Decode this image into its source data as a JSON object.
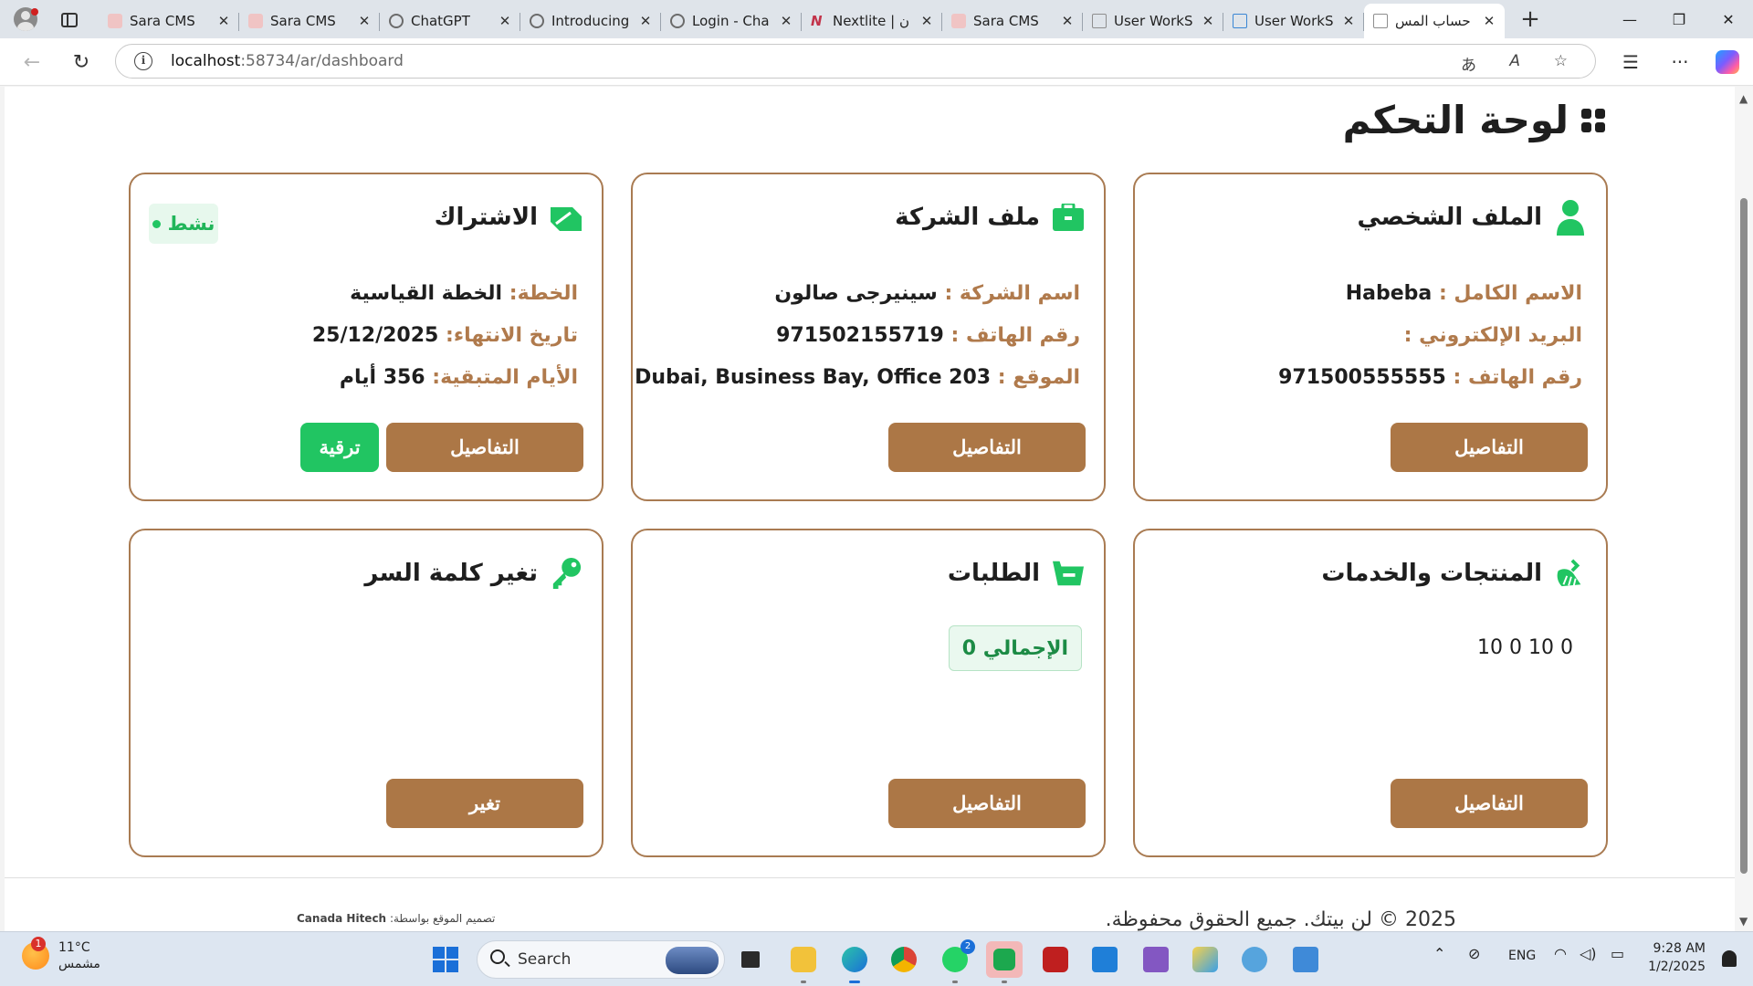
{
  "browser": {
    "tabs": [
      {
        "label": "Sara CMS",
        "favicon_color": "#d98a8a"
      },
      {
        "label": "Sara CMS",
        "favicon_color": "#d98a8a"
      },
      {
        "label": "ChatGPT",
        "favicon_color": "#6b6b6b"
      },
      {
        "label": "Introducing",
        "favicon_color": "#6b6b6b"
      },
      {
        "label": "Login - Cha",
        "favicon_color": "#6b6b6b"
      },
      {
        "label": "Nextlite | ن",
        "favicon_color": "#c2334a"
      },
      {
        "label": "Sara CMS",
        "favicon_color": "#d98a8a"
      },
      {
        "label": "User WorkS",
        "favicon_color": "#8e8e8e"
      },
      {
        "label": "User WorkS",
        "favicon_color": "#3a86d4"
      },
      {
        "label": "حساب المس",
        "favicon_color": "#8e8e8e",
        "active": true
      }
    ],
    "url_host": "localhost",
    "url_path": ":58734/ar/dashboard",
    "read_aloud": "A",
    "translate": "あ"
  },
  "page": {
    "title": "لوحة التحكم",
    "cards": {
      "profile": {
        "title": "الملف الشخصي",
        "rows": [
          {
            "label": "الاسم الكامل :",
            "value": "Habeba"
          },
          {
            "label": "البريد الإلكتروني :",
            "value": ""
          },
          {
            "label": "رقم الهاتف :",
            "value": "971500555555"
          }
        ],
        "button": "التفاصيل"
      },
      "company": {
        "title": "ملف الشركة",
        "rows": [
          {
            "label": "اسم الشركة :",
            "value": "سينيرجى صالون"
          },
          {
            "label": "رقم الهاتف :",
            "value": "971502155719"
          },
          {
            "label": "الموقع :",
            "value": "Dubai, Business Bay, Office 203"
          }
        ],
        "button": "التفاصيل"
      },
      "subscription": {
        "title": "الاشتراك",
        "status": "نشط",
        "rows": [
          {
            "label": "الخطة:",
            "value": "الخطة القياسية"
          },
          {
            "label": "تاريخ الانتهاء:",
            "value": "25/12/2025"
          },
          {
            "label": "الأيام المتبقية:",
            "value": "356 أيام"
          }
        ],
        "button": "التفاصيل",
        "upgrade_button": "ترقية"
      },
      "products": {
        "title": "المنتجات والخدمات",
        "values": "10 0 10 0",
        "button": "التفاصيل"
      },
      "orders": {
        "title": "الطلبات",
        "total_label": "الإجمالي 0",
        "button": "التفاصيل"
      },
      "password": {
        "title": "تغير كلمة السر",
        "button": "تغير"
      }
    },
    "footer": {
      "copyright": "2025 © لن بيتك. جميع الحقوق محفوظة.",
      "design_label": "تصميم الموقع بواسطة:",
      "design_company": "Canada Hitech"
    }
  },
  "taskbar": {
    "weather_temp": "11°C",
    "weather_desc": "مشمس",
    "weather_badge": "1",
    "search_placeholder": "Search",
    "whatsapp_badge": "2",
    "language": "ENG",
    "time": "9:28 AM",
    "date": "1/2/2025"
  },
  "colors": {
    "accent_brown": "#ac7746",
    "card_border": "#a97b52",
    "label_brown": "#b07a4c",
    "accent_green": "#21c562"
  }
}
